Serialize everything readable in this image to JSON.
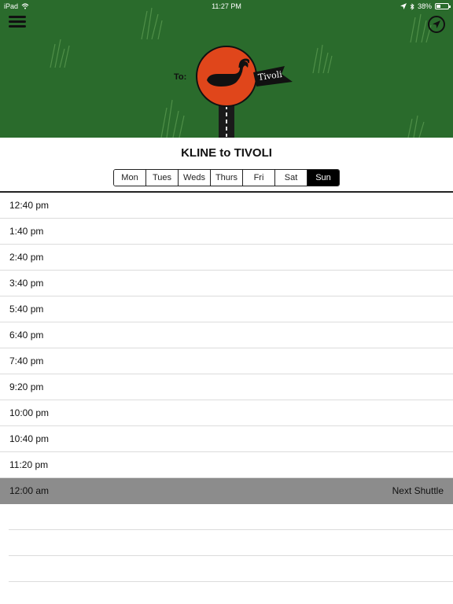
{
  "status_bar": {
    "device": "iPad",
    "time": "11:27 PM",
    "battery": "38%",
    "battery_level": 0.38
  },
  "icons": {
    "menu": "hamburger-menu-icon",
    "locate": "navigation-arrow-icon",
    "wifi": "wifi-icon",
    "location": "location-arrow-icon",
    "bluetooth": "bluetooth-icon"
  },
  "header": {
    "to_label": "To:",
    "sign_destination": "Tivoli"
  },
  "colors": {
    "banner": "#2a6b2c",
    "sign": "#e0461b",
    "next_row": "#8c8c8c"
  },
  "route_title": "KLINE to TIVOLI",
  "days": [
    {
      "label": "Mon",
      "active": false
    },
    {
      "label": "Tues",
      "active": false
    },
    {
      "label": "Weds",
      "active": false
    },
    {
      "label": "Thurs",
      "active": false
    },
    {
      "label": "Fri",
      "active": false
    },
    {
      "label": "Sat",
      "active": false
    },
    {
      "label": "Sun",
      "active": true
    }
  ],
  "schedule": [
    {
      "time": "12:40 pm"
    },
    {
      "time": "1:40 pm"
    },
    {
      "time": "2:40 pm"
    },
    {
      "time": "3:40 pm"
    },
    {
      "time": "5:40 pm"
    },
    {
      "time": "6:40 pm"
    },
    {
      "time": "7:40 pm"
    },
    {
      "time": "9:20 pm"
    },
    {
      "time": "10:00 pm"
    },
    {
      "time": "10:40 pm"
    },
    {
      "time": "11:20 pm"
    },
    {
      "time": "12:00 am",
      "note": "Next Shuttle",
      "next": true
    }
  ]
}
